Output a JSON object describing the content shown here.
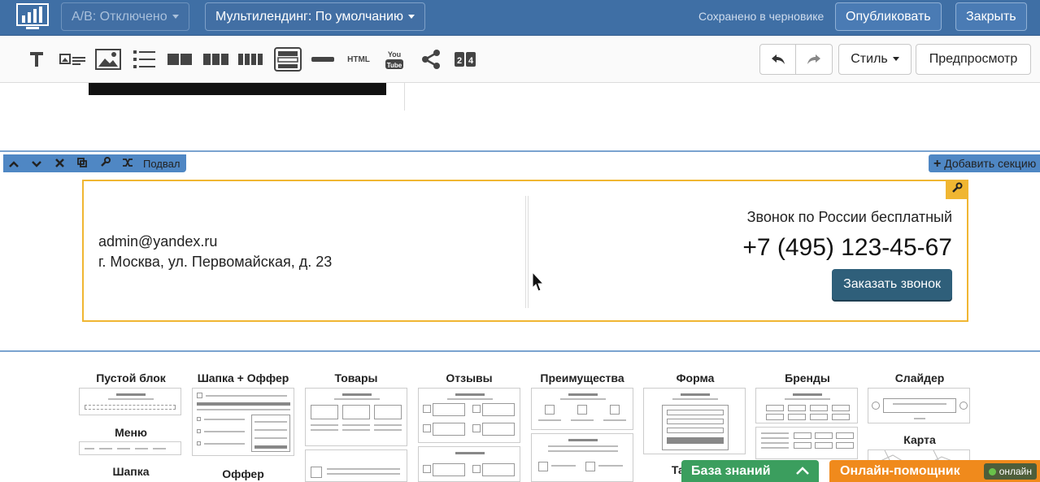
{
  "topbar": {
    "ab_label": "A/B: Отключено",
    "multilanding_label": "Мультилендинг: По умолчанию",
    "saved_text": "Сохранено в черновике",
    "publish_label": "Опубликовать",
    "close_label": "Закрыть"
  },
  "toolbar": {
    "tools": [
      "text-icon",
      "image-text-icon",
      "image-icon",
      "list-icon",
      "two-columns-icon",
      "three-columns-icon",
      "four-columns-icon",
      "form-block-icon",
      "divider-icon",
      "html-icon",
      "youtube-icon",
      "share-icon",
      "timer-icon"
    ],
    "html_label": "HTML",
    "youtube_label": "You Tube",
    "timer_label": "2:4",
    "style_label": "Стиль",
    "preview_label": "Предпросмотр"
  },
  "section": {
    "name": "Подвал",
    "add_section_label": "Добавить секцию"
  },
  "footer": {
    "email": "admin@yandex.ru",
    "address": "г. Москва, ул. Первомайская, д. 23",
    "call_note": "Звонок по России бесплатный",
    "phone": "+7 (495) 123-45-67",
    "call_button": "Заказать звонок"
  },
  "catalog": {
    "empty_block": "Пустой блок",
    "menu": "Меню",
    "header": "Шапка",
    "header_offer": "Шапка + Оффер",
    "offer": "Оффер",
    "products": "Товары",
    "reviews": "Отзывы",
    "advantages": "Преимущества",
    "form": "Форма",
    "table": "Таблица",
    "brands": "Бренды",
    "slider": "Слайдер",
    "map": "Карта"
  },
  "widgets": {
    "knowledge_base": "База знаний",
    "online_helper": "Онлайн-помощник",
    "online_status": "онлайн"
  },
  "colors": {
    "topbar": "#3f6fa5",
    "accent_orange": "#f08a1c",
    "accent_green": "#3b9e5e",
    "selection_border": "#f0b632",
    "call_button": "#2f5f7a"
  }
}
